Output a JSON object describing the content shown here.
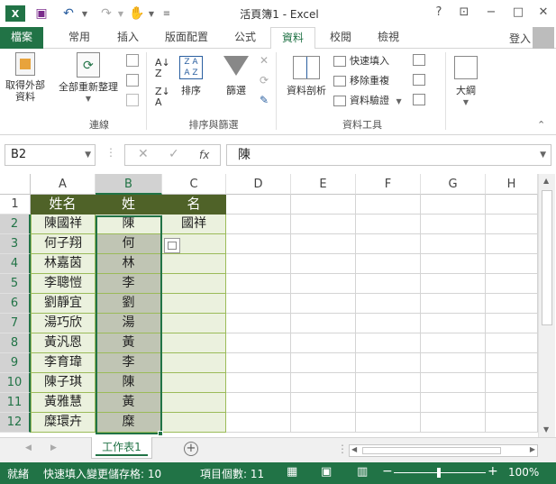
{
  "window": {
    "title": "活頁簿1 - Excel",
    "help": "?",
    "buttons": [
      "restore",
      "minimize",
      "maximize",
      "close"
    ]
  },
  "tabs": [
    "檔案",
    "常用",
    "插入",
    "版面配置",
    "公式",
    "資料",
    "校閱",
    "檢視"
  ],
  "active_tab": "資料",
  "signin": "登入",
  "ribbon": {
    "get_external": "取得外部\n資料",
    "refresh_all": "全部重新整理",
    "group_connections": "連線",
    "sort": "排序",
    "filter": "篩選",
    "group_sort_filter": "排序與篩選",
    "text_to_columns": "資料剖析",
    "flash_fill": "快速填入",
    "remove_duplicates": "移除重複",
    "data_validation": "資料驗證",
    "group_data_tools": "資料工具",
    "outline": "大綱"
  },
  "formula_bar": {
    "name_box": "B2",
    "fx": "fx",
    "value": "陳"
  },
  "columns": [
    "A",
    "B",
    "C",
    "D",
    "E",
    "F",
    "G",
    "H"
  ],
  "rows": [
    "1",
    "2",
    "3",
    "4",
    "5",
    "6",
    "7",
    "8",
    "9",
    "10",
    "11",
    "12"
  ],
  "cells": {
    "A": [
      "姓名",
      "陳國祥",
      "何子翔",
      "林嘉茵",
      "李聰愷",
      "劉靜宜",
      "湯巧欣",
      "黃汎恩",
      "李育瑋",
      "陳子琪",
      "黃雅慧",
      "糜環卉"
    ],
    "B": [
      "姓",
      "陳",
      "何",
      "林",
      "李",
      "劉",
      "湯",
      "黃",
      "李",
      "陳",
      "黃",
      "糜"
    ],
    "C": [
      "名",
      "國祥",
      "",
      "",
      "",
      "",
      "",
      "",
      "",
      "",
      "",
      ""
    ]
  },
  "sheet_tab": "工作表1",
  "status": {
    "ready": "就緒",
    "flash_fill_info": "快速填入變更儲存格: 10",
    "count": "項目個數: 11",
    "zoom": "100%"
  },
  "colors": {
    "excel_green": "#217346",
    "header_fill": "#4f6228",
    "light_fill": "#ebf1de",
    "selection_fill": "#c0c5b4"
  }
}
